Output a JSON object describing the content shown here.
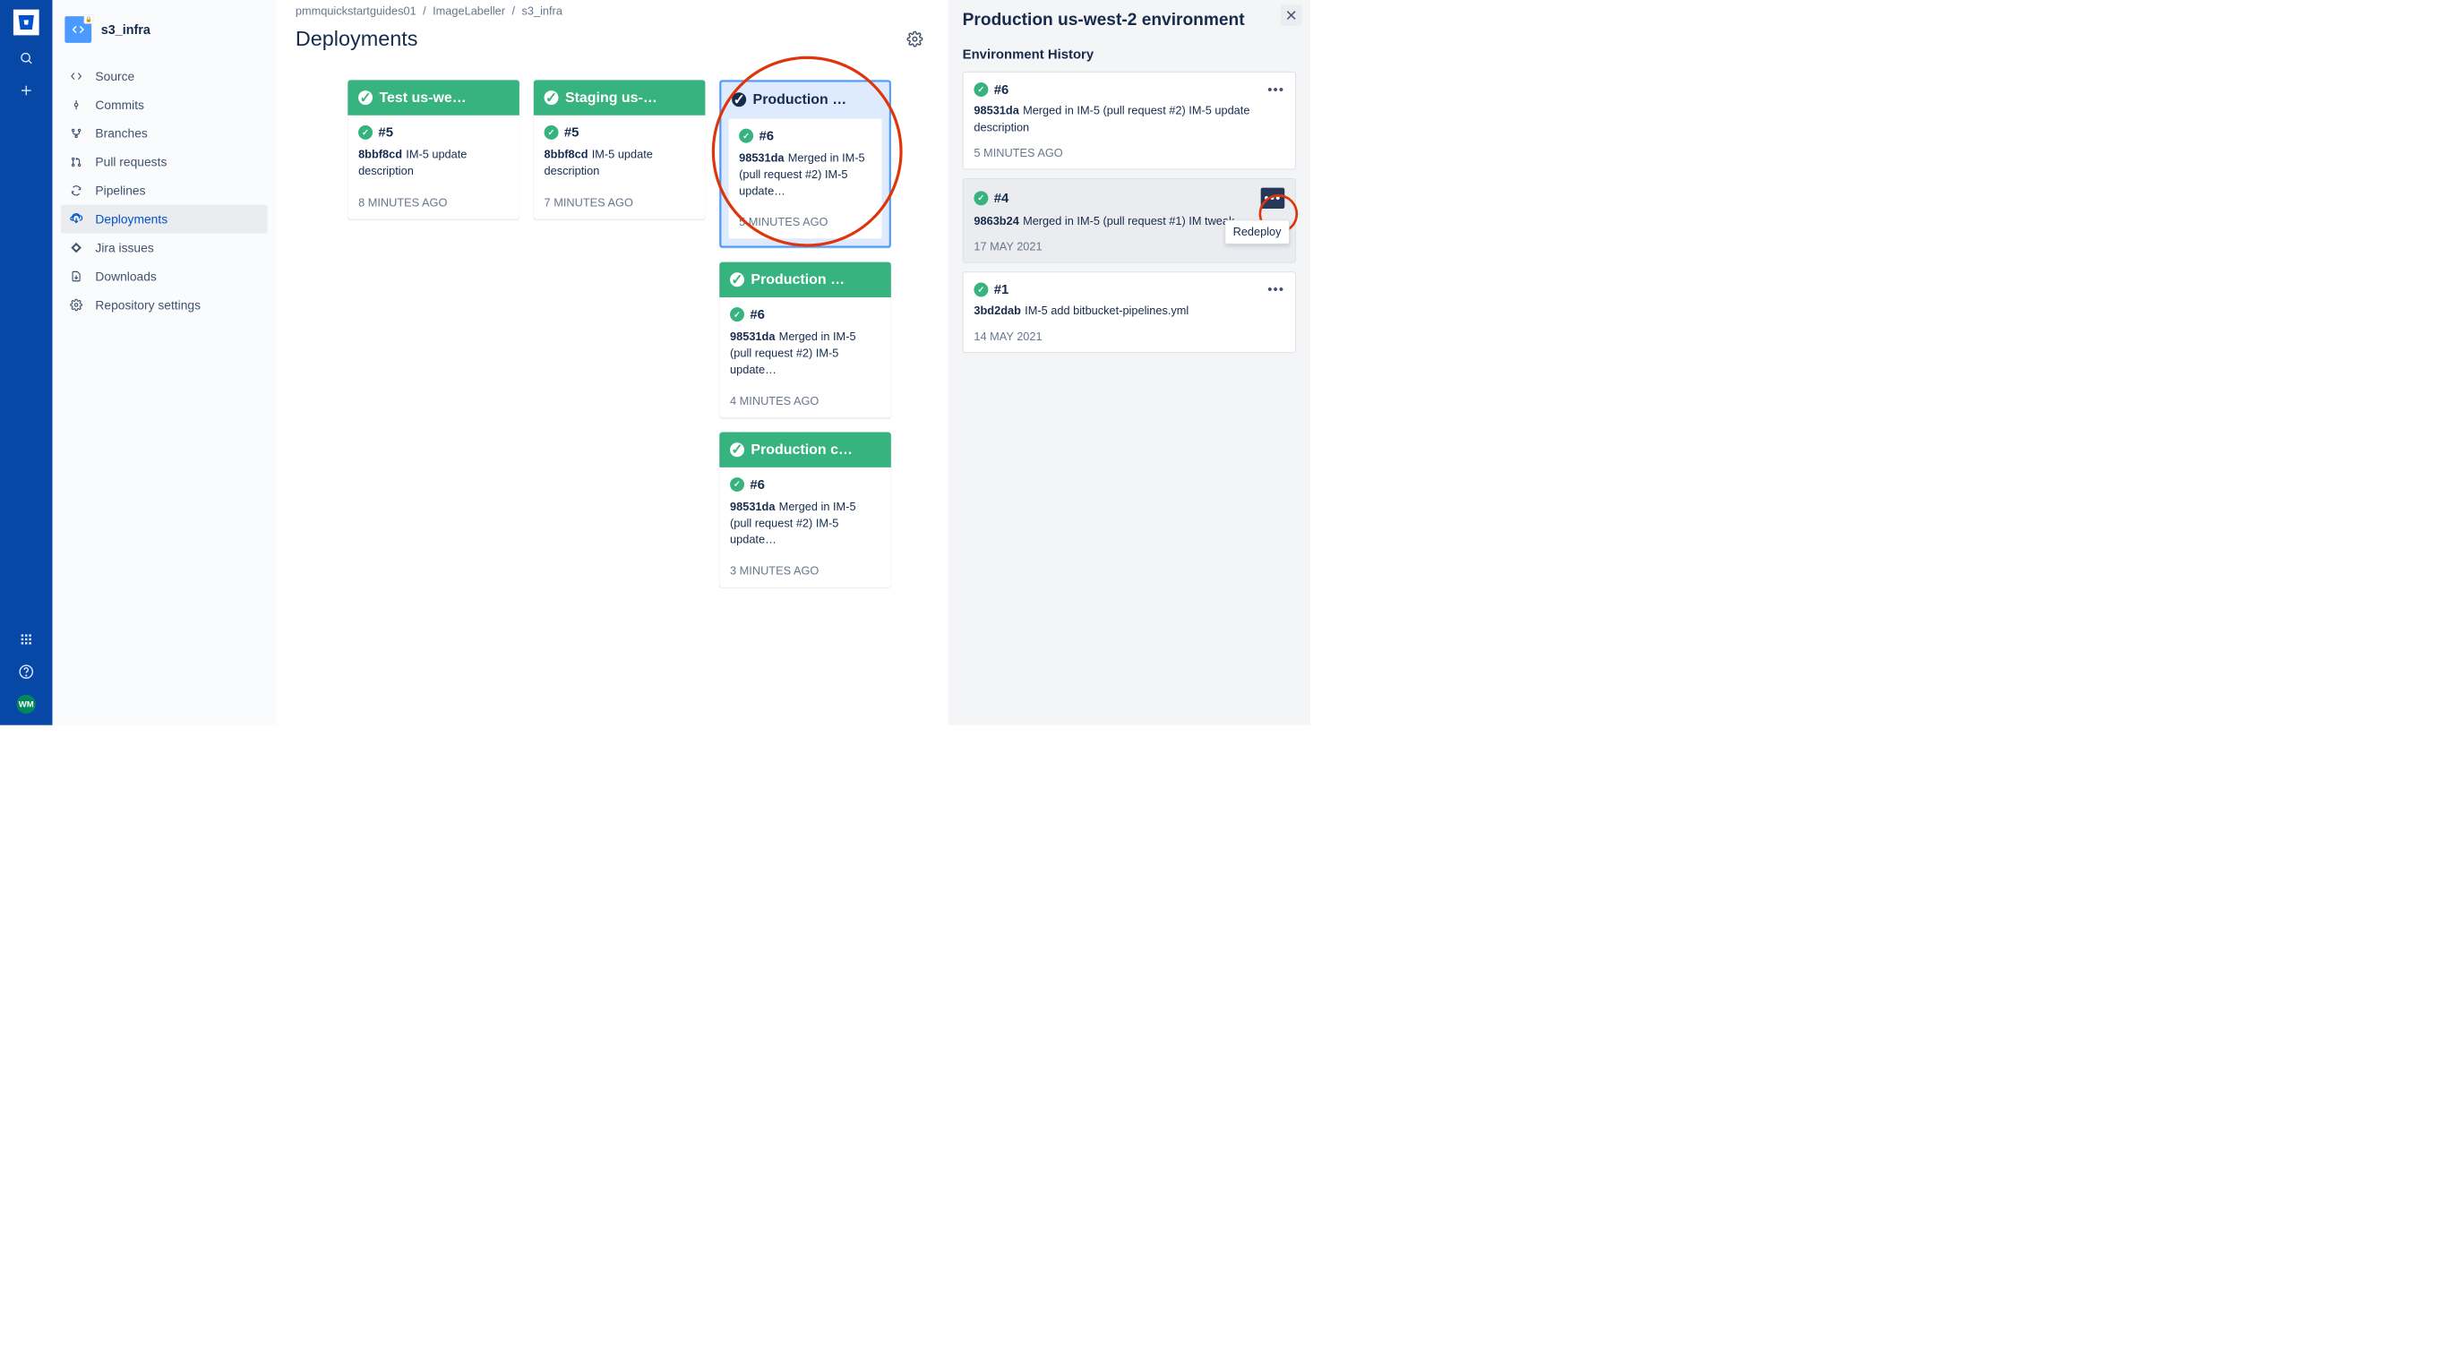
{
  "global_nav": {
    "avatar_initials": "WM"
  },
  "sidebar": {
    "repo_name": "s3_infra",
    "items": [
      {
        "label": "Source"
      },
      {
        "label": "Commits"
      },
      {
        "label": "Branches"
      },
      {
        "label": "Pull requests"
      },
      {
        "label": "Pipelines"
      },
      {
        "label": "Deployments"
      },
      {
        "label": "Jira issues"
      },
      {
        "label": "Downloads"
      },
      {
        "label": "Repository settings"
      }
    ]
  },
  "breadcrumbs": [
    "pmmquickstartguides01",
    "ImageLabeller",
    "s3_infra"
  ],
  "page_title": "Deployments",
  "environments": {
    "col1": {
      "name": "Test us-we…",
      "deploy": {
        "num": "#5",
        "sha": "8bbf8cd",
        "msg": "IM-5 update description",
        "time": "8 MINUTES AGO"
      }
    },
    "col2": {
      "name": "Staging us-…",
      "deploy": {
        "num": "#5",
        "sha": "8bbf8cd",
        "msg": "IM-5 update description",
        "time": "7 MINUTES AGO"
      }
    },
    "col3": [
      {
        "name": "Production …",
        "selected": true,
        "deploy": {
          "num": "#6",
          "sha": "98531da",
          "msg": "Merged in IM-5 (pull request #2) IM-5 update…",
          "time": "5 MINUTES AGO"
        }
      },
      {
        "name": "Production …",
        "deploy": {
          "num": "#6",
          "sha": "98531da",
          "msg": "Merged in IM-5 (pull request #2) IM-5 update…",
          "time": "4 MINUTES AGO"
        }
      },
      {
        "name": "Production c…",
        "deploy": {
          "num": "#6",
          "sha": "98531da",
          "msg": "Merged in IM-5 (pull request #2) IM-5 update…",
          "time": "3 MINUTES AGO"
        }
      }
    ]
  },
  "history_panel": {
    "title": "Production us-west-2 environment",
    "subtitle": "Environment History",
    "tooltip": "Redeploy",
    "items": [
      {
        "num": "#6",
        "sha": "98531da",
        "msg": "Merged in IM-5 (pull request #2) IM-5 update description",
        "time": "5 MINUTES AGO"
      },
      {
        "num": "#4",
        "sha": "9863b24",
        "msg": "Merged in IM-5 (pull request #1) IM tweak",
        "time": "17 MAY 2021"
      },
      {
        "num": "#1",
        "sha": "3bd2dab",
        "msg": "IM-5 add bitbucket-pipelines.yml",
        "time": "14 MAY 2021"
      }
    ]
  }
}
